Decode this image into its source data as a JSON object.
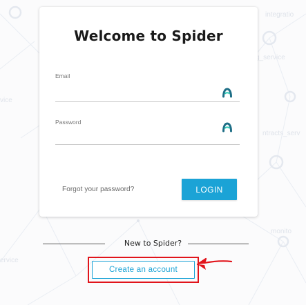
{
  "card": {
    "title": "Welcome to Spider",
    "email": {
      "label": "Email",
      "value": "",
      "autofill_icon": "password-manager-icon"
    },
    "password": {
      "label": "Password",
      "value": "",
      "autofill_icon": "password-manager-icon"
    },
    "forgot_link": "Forgot your password?",
    "login_button": "LOGIN"
  },
  "signup": {
    "prompt": "New to Spider?",
    "create_button": "Create an account"
  },
  "annotation": {
    "highlight_color": "#e1141b",
    "arrow": "arrow-pointer-icon"
  },
  "colors": {
    "accent": "#1ba3d6",
    "background": "#fbfbfc",
    "card": "#ffffff"
  },
  "background_labels": {
    "top_right": "integratio",
    "right_1": "g_service",
    "left_1": "vice",
    "right_2": "ntracts_serv",
    "right_3": "monito",
    "left_2": "ervice"
  }
}
